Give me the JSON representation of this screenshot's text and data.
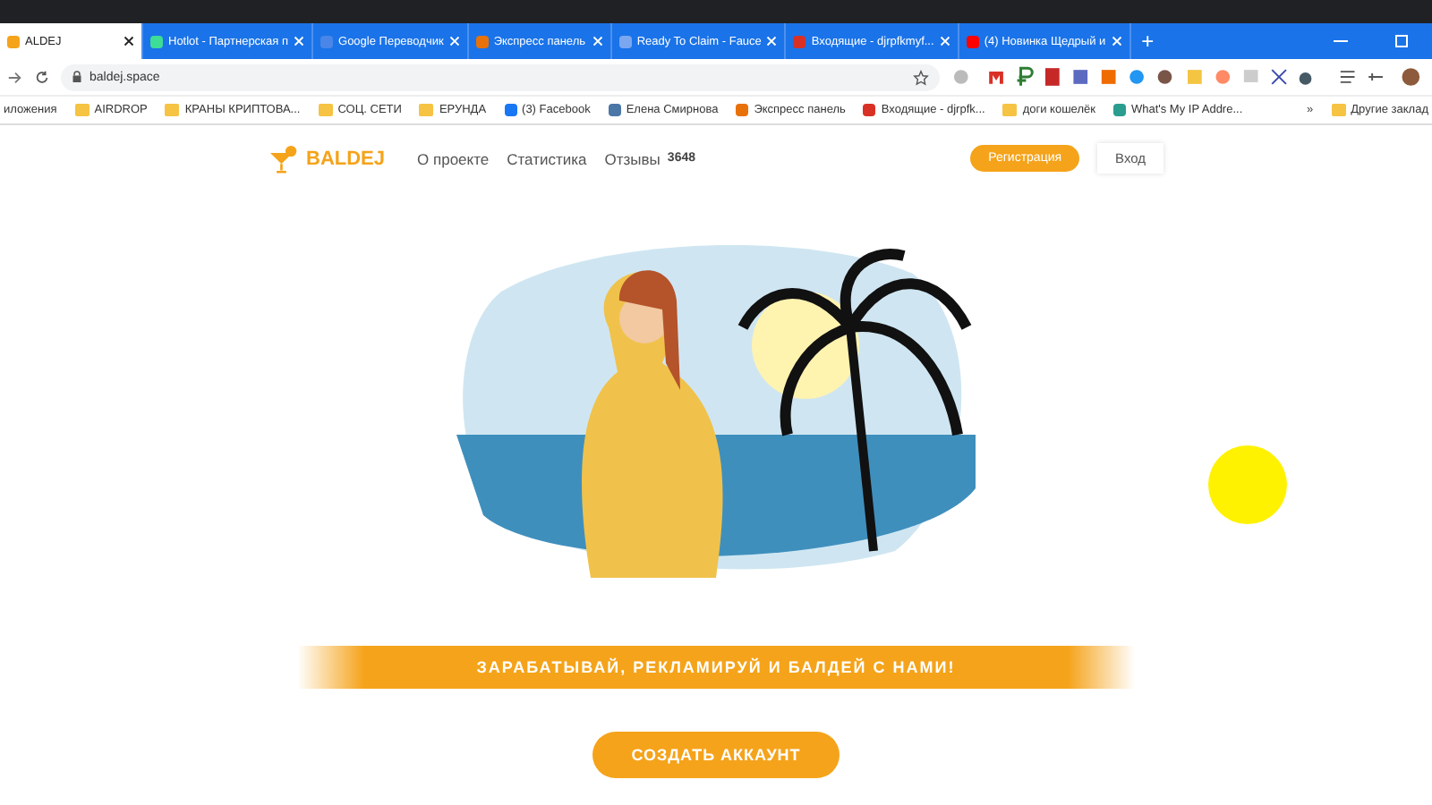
{
  "browser": {
    "tabs": [
      {
        "label": "ALDEJ",
        "selected": true,
        "color": "#f5a31a"
      },
      {
        "label": "Hotlot - Партнерская п",
        "selected": false,
        "color": "#3ddc97"
      },
      {
        "label": "Google Переводчик",
        "selected": false,
        "color": "#4a86e8"
      },
      {
        "label": "Экспресс панель",
        "selected": false,
        "color": "#e8710a"
      },
      {
        "label": "Ready To Claim - Fauce",
        "selected": false,
        "color": "#7aa7f0"
      },
      {
        "label": "Входящие - djrpfkmyf...",
        "selected": false,
        "color": "#d93025"
      },
      {
        "label": "(4) Новинка Щедрый и",
        "selected": false,
        "color": "#ff0000"
      }
    ],
    "new_tab": "+",
    "address": "baldej.space",
    "bookmarks": [
      {
        "label": "иложения",
        "kind": "plain"
      },
      {
        "label": "AIRDROP",
        "kind": "folder"
      },
      {
        "label": "КРАНЫ КРИПТОВА...",
        "kind": "folder"
      },
      {
        "label": "СОЦ. СЕТИ",
        "kind": "folder"
      },
      {
        "label": "ЕРУНДА",
        "kind": "folder"
      },
      {
        "label": "(3) Facebook",
        "kind": "site",
        "color": "#1877f2"
      },
      {
        "label": "Елена Смирнова",
        "kind": "site",
        "color": "#4a76a8"
      },
      {
        "label": "Экспресс панель",
        "kind": "site",
        "color": "#e8710a"
      },
      {
        "label": "Входящие - djrpfk...",
        "kind": "site",
        "color": "#d93025"
      },
      {
        "label": "доги кошелёк",
        "kind": "folder"
      },
      {
        "label": "What's My IP Addre...",
        "kind": "site",
        "color": "#2a9d8f"
      }
    ],
    "more_bookmarks": "»",
    "other_bookmarks": "Другие заклад"
  },
  "site": {
    "logo": "BALDEJ",
    "nav": [
      {
        "label": "О проекте"
      },
      {
        "label": "Статистика"
      },
      {
        "label": "Отзывы",
        "count": "3648"
      }
    ],
    "register": "Регистрация",
    "login": "Вход",
    "slogan": "ЗАРАБАТЫВАЙ, РЕКЛАМИРУЙ И БАЛДЕЙ С НАМИ!",
    "cta": "СОЗДАТЬ АККАУНТ"
  }
}
